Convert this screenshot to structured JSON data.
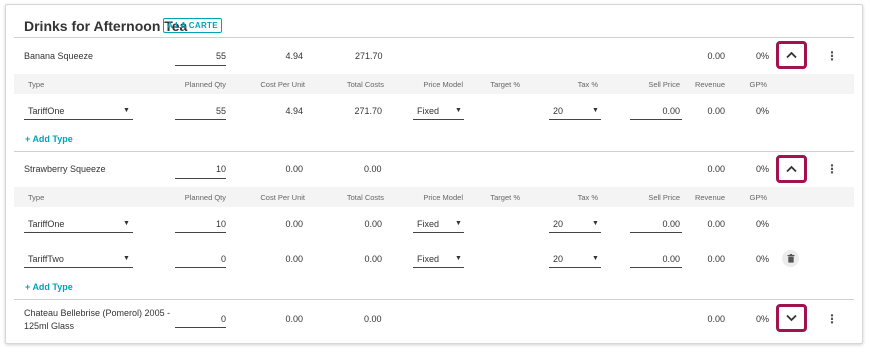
{
  "section": {
    "title": "Drinks for Afternoon Tea",
    "badge": "A LA CARTE"
  },
  "headers": {
    "type": "Type",
    "planned_qty": "Planned Qty",
    "cost_per_unit": "Cost Per Unit",
    "total_costs": "Total Costs",
    "price_model": "Price Model",
    "target_pct": "Target %",
    "tax_pct": "Tax %",
    "sell_price": "Sell Price",
    "revenue": "Revenue",
    "gp_pct": "GP%"
  },
  "add_type_label": "Add Type",
  "items": [
    {
      "name": "Banana Squeeze",
      "qty": "55",
      "cost_per_unit": "4.94",
      "total_costs": "271.70",
      "revenue": "0.00",
      "gp": "0%",
      "expanded": true,
      "types": [
        {
          "type": "TariffOne",
          "qty": "55",
          "cost_per_unit": "4.94",
          "total_costs": "271.70",
          "price_model": "Fixed",
          "tax": "20",
          "sell_price": "0.00",
          "revenue": "0.00",
          "gp": "0%"
        }
      ]
    },
    {
      "name": "Strawberry Squeeze",
      "qty": "10",
      "cost_per_unit": "0.00",
      "total_costs": "0.00",
      "revenue": "0.00",
      "gp": "0%",
      "expanded": true,
      "types": [
        {
          "type": "TariffOne",
          "qty": "10",
          "cost_per_unit": "0.00",
          "total_costs": "0.00",
          "price_model": "Fixed",
          "tax": "20",
          "sell_price": "0.00",
          "revenue": "0.00",
          "gp": "0%"
        },
        {
          "type": "TariffTwo",
          "qty": "0",
          "cost_per_unit": "0.00",
          "total_costs": "0.00",
          "price_model": "Fixed",
          "tax": "20",
          "sell_price": "0.00",
          "revenue": "0.00",
          "gp": "0%"
        }
      ]
    },
    {
      "name_line1": "Chateau Bellebrise (Pomerol) 2005 -",
      "name_line2": "125ml Glass",
      "qty": "0",
      "cost_per_unit": "0.00",
      "total_costs": "0.00",
      "revenue": "0.00",
      "gp": "0%",
      "expanded": false
    }
  ],
  "icons": {
    "collapse": "chevron-up-icon",
    "expand": "chevron-down-icon",
    "menu": "more-vertical-icon",
    "delete": "trash-icon",
    "dropdown": "caret-down-icon",
    "add": "plus-icon"
  },
  "colors": {
    "accent": "#00a5b5",
    "highlight": "#a0134f"
  }
}
